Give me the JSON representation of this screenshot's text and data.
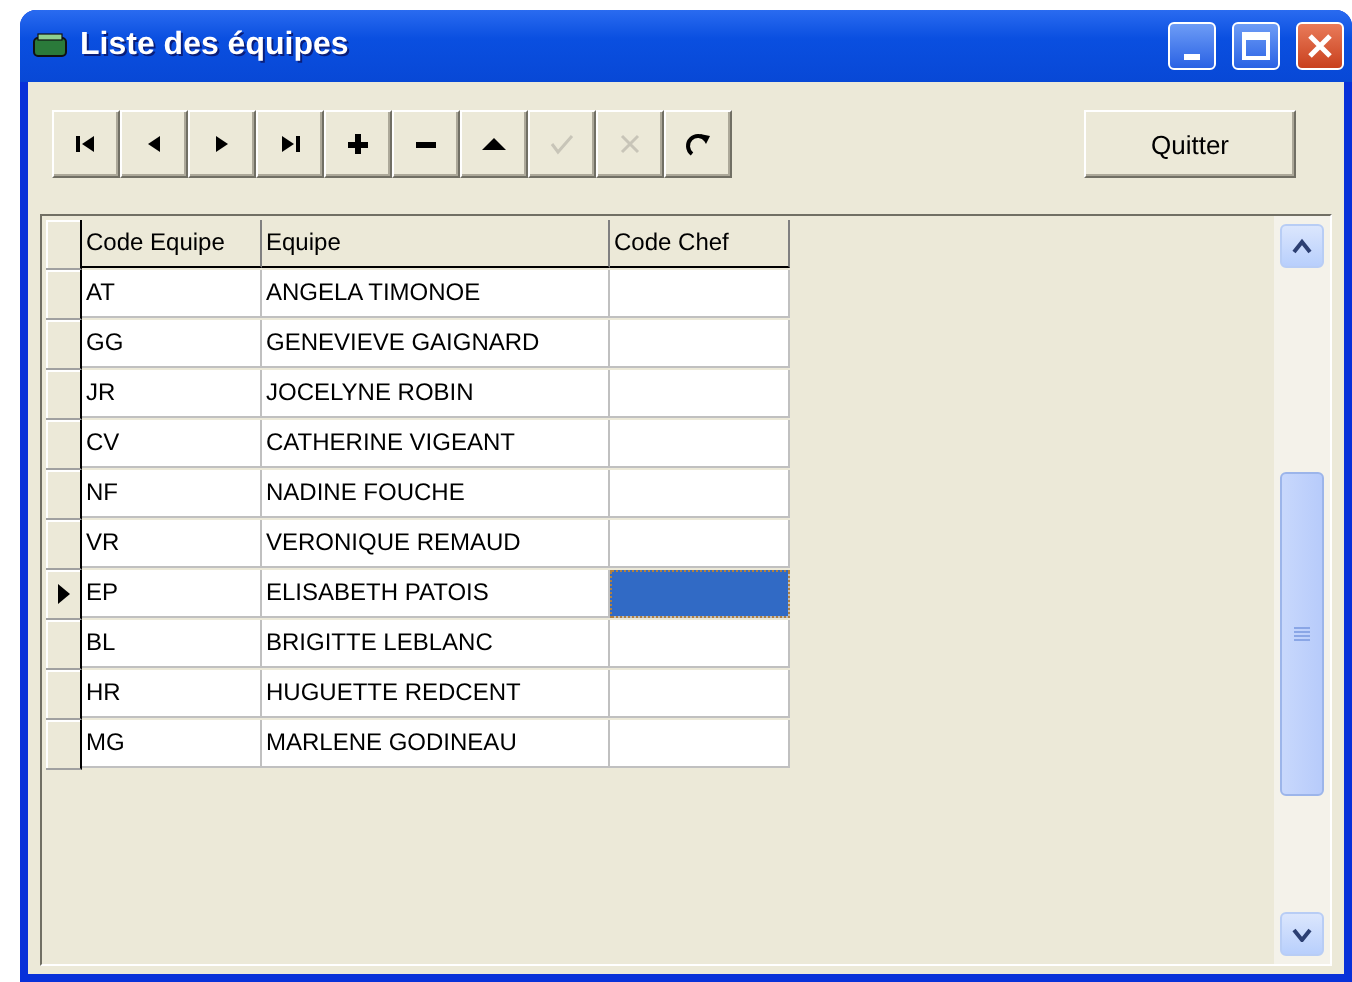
{
  "window": {
    "title": "Liste des équipes"
  },
  "toolbar": [
    {
      "kind": "first",
      "disabled": false
    },
    {
      "kind": "prev",
      "disabled": false
    },
    {
      "kind": "next",
      "disabled": false
    },
    {
      "kind": "last",
      "disabled": false
    },
    {
      "kind": "add",
      "disabled": false
    },
    {
      "kind": "delete",
      "disabled": false
    },
    {
      "kind": "edit",
      "disabled": false
    },
    {
      "kind": "post",
      "disabled": true
    },
    {
      "kind": "cancel",
      "disabled": true
    },
    {
      "kind": "refresh",
      "disabled": false
    }
  ],
  "quit_button": "Quitter",
  "table": {
    "columns": [
      "Code Equipe",
      "Equipe",
      "Code Chef"
    ],
    "rows": [
      {
        "cells": [
          "AT",
          "ANGELA TIMONOE",
          ""
        ],
        "selected": false
      },
      {
        "cells": [
          "GG",
          "GENEVIEVE GAIGNARD",
          ""
        ],
        "selected": false
      },
      {
        "cells": [
          "JR",
          "JOCELYNE ROBIN",
          ""
        ],
        "selected": false
      },
      {
        "cells": [
          "CV",
          "CATHERINE VIGEANT",
          ""
        ],
        "selected": false
      },
      {
        "cells": [
          "NF",
          "NADINE FOUCHE",
          ""
        ],
        "selected": false
      },
      {
        "cells": [
          "VR",
          "VERONIQUE REMAUD",
          ""
        ],
        "selected": false
      },
      {
        "cells": [
          "EP",
          "ELISABETH PATOIS",
          ""
        ],
        "selected": true
      },
      {
        "cells": [
          "BL",
          "BRIGITTE LEBLANC",
          ""
        ],
        "selected": false
      },
      {
        "cells": [
          "HR",
          "HUGUETTE REDCENT",
          ""
        ],
        "selected": false
      },
      {
        "cells": [
          "MG",
          "MARLENE GODINEAU",
          ""
        ],
        "selected": false
      }
    ]
  }
}
